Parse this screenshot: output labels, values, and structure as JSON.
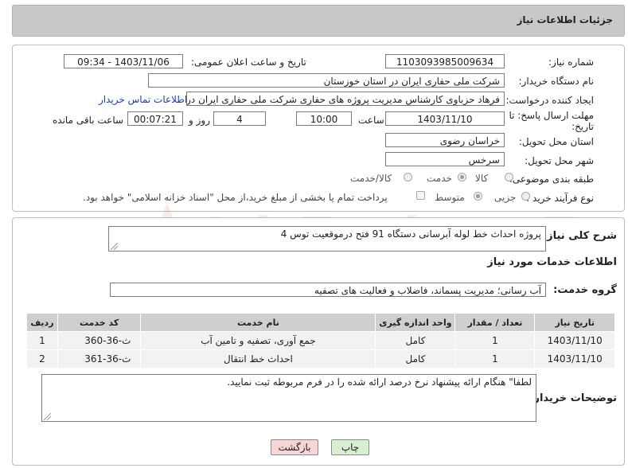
{
  "header": {
    "title": "جزئیات اطلاعات نیاز"
  },
  "form": {
    "need_number": {
      "label": "شماره نیاز:",
      "value": "1103093985009634"
    },
    "announce_datetime": {
      "label": "تاریخ و ساعت اعلان عمومی:",
      "value": "1403/11/06 - 09:34"
    },
    "buyer_org": {
      "label": "نام دستگاه خریدار:",
      "value": "شرکت ملی حفاری ایران در استان خوزستان"
    },
    "requester": {
      "label": "ایجاد کننده درخواست:",
      "value": "فرهاد حزباوی کارشناس مدیریت پروژه های حفاری شرکت ملی حفاری ایران در اه",
      "contact_link": "اطلاعات تماس خریدار"
    },
    "deadline": {
      "label_line1": "مهلت ارسال پاسخ: تا",
      "label_line2": "تاریخ:",
      "date": "1403/11/10",
      "time_label": "ساعت",
      "time": "10:00",
      "days": "4",
      "days_label": "روز و",
      "remaining": "00:07:21",
      "remaining_label": "ساعت باقی مانده"
    },
    "province": {
      "label": "استان محل تحویل:",
      "value": "خراسان رضوی"
    },
    "city": {
      "label": "شهر محل تحویل:",
      "value": "سرخس"
    },
    "category": {
      "label": "طبقه بندی موضوعی:",
      "options": [
        "کالا",
        "خدمت",
        "کالا/خدمت"
      ],
      "selected": "خدمت"
    },
    "process": {
      "label": "نوع فرآیند خرید :",
      "options": [
        "جزیی",
        "متوسط"
      ],
      "selected": "متوسط",
      "note": "پرداخت تمام یا بخشی از مبلغ خرید،از محل \"اسناد خزانه اسلامی\" خواهد بود."
    }
  },
  "summary": {
    "label": "شرح کلی نیاز:",
    "value": "پروژه احداث خط لوله آبرسانی دستگاه 91 فتح درموقعیت توس 4"
  },
  "services_section": {
    "title": "اطلاعات خدمات مورد نیاز"
  },
  "service_group": {
    "label": "گروه خدمت:",
    "value": "آب رسانی؛ مدیریت پسماند، فاضلاب و فعالیت های تصفیه"
  },
  "table": {
    "headers": [
      "ردیف",
      "کد خدمت",
      "نام خدمت",
      "واحد اندازه گیری",
      "تعداد / مقدار",
      "تاریخ نیاز"
    ],
    "rows": [
      [
        "1",
        "ث-36-360",
        "جمع آوری، تصفیه و تامین آب",
        "کامل",
        "1",
        "1403/11/10"
      ],
      [
        "2",
        "ث-36-361",
        "احداث خط انتقال",
        "کامل",
        "1",
        "1403/11/10"
      ]
    ]
  },
  "buyer_notes": {
    "label": "توضیحات خریدار:",
    "value": "لطفا\" هنگام ارائه پیشنهاد نرخ درصد ارائه شده را در فرم مربوطه ثبت نمایید."
  },
  "buttons": {
    "print": "چاپ",
    "back": "بازگشت"
  },
  "watermark": {
    "text": "AriaTender.neT"
  },
  "colors": {
    "header_bg": "#c8c8c8",
    "link": "#1a3fb5",
    "back_button": "#f6d6d6",
    "print_button": "#d8f0d0"
  }
}
